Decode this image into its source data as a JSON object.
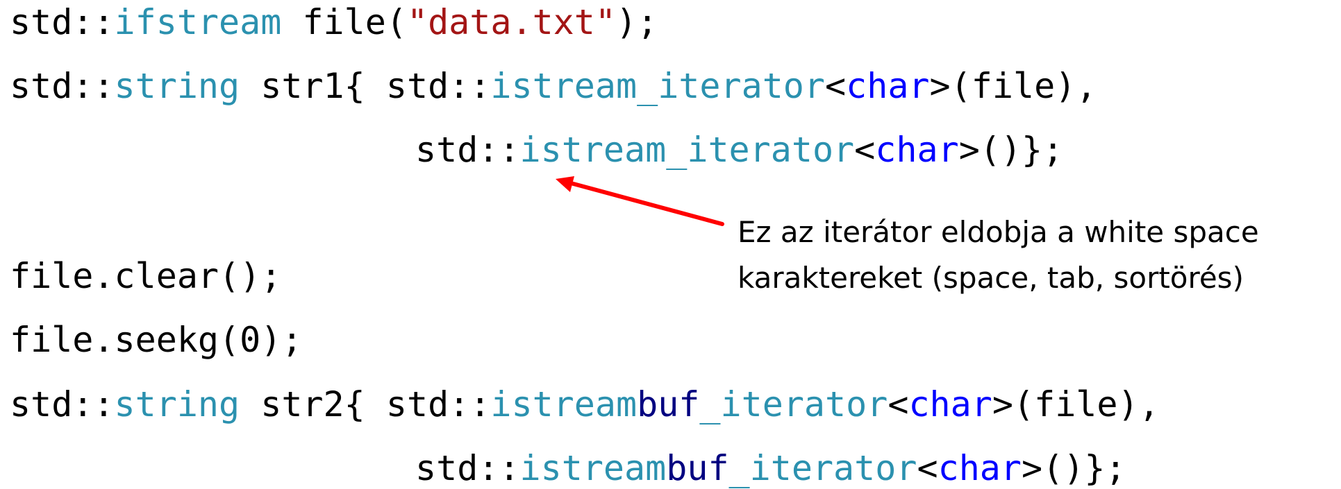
{
  "code": {
    "line1": {
      "ns": "std::",
      "type": "ifstream",
      "rest": " file(",
      "str": "\"data.txt\"",
      "end": ");"
    },
    "line2": {
      "ns": "std::",
      "type": "string",
      "mid": " str1{ std::",
      "iter": "istream_iterator",
      "lt": "<",
      "kw": "char",
      "gt": ">",
      "end": "(file),"
    },
    "line3": {
      "ns": "std::",
      "iter": "istream_iterator",
      "lt": "<",
      "kw": "char",
      "gt": ">",
      "end": "()};"
    },
    "line4": "file.clear();",
    "line5": "file.seekg(0);",
    "line6": {
      "ns": "std::",
      "type": "string",
      "mid": " str2{ std::",
      "iter_a": "istream",
      "iter_b": "buf",
      "iter_c": "_iterator",
      "lt": "<",
      "kw": "char",
      "gt": ">",
      "end": "(file),"
    },
    "line7": {
      "ns": "std::",
      "iter_a": "istream",
      "iter_b": "buf",
      "iter_c": "_iterator",
      "lt": "<",
      "kw": "char",
      "gt": ">",
      "end": "()};"
    }
  },
  "annotation": {
    "line1": "Ez az iterátor eldobja a white space",
    "line2": "karaktereket (space, tab, sortörés)"
  },
  "colors": {
    "type": "#2b91af",
    "keyword": "#0000ff",
    "string": "#a31515",
    "arrow": "#ff0000"
  }
}
